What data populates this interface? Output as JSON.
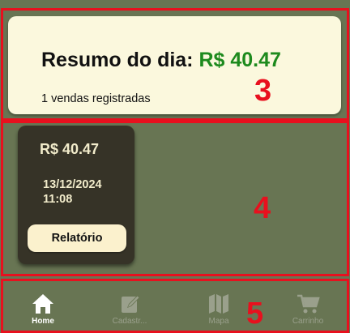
{
  "summary": {
    "title": "Resumo do dia:",
    "amount": "R$ 40.47",
    "subtitle": "1 vendas registradas"
  },
  "sales": [
    {
      "amount": "R$ 40.47",
      "date": "13/12/2024",
      "time": "11:08",
      "report_label": "Relatório"
    }
  ],
  "nav": {
    "items": [
      {
        "label": "Home",
        "icon": "home-icon",
        "active": true
      },
      {
        "label": "Cadastr...",
        "icon": "edit-icon",
        "active": false
      },
      {
        "label": "Mapa",
        "icon": "map-icon",
        "active": false
      },
      {
        "label": "Carrinho",
        "icon": "cart-icon",
        "active": false
      }
    ]
  },
  "annotations": {
    "summary_region": "3",
    "list_region": "4",
    "nav_region": "5"
  },
  "colors": {
    "background": "#687553",
    "summary_card": "#fbf8dd",
    "amount_green": "#1d8a1d",
    "sale_card": "#363327",
    "annotation_red": "#e8101e",
    "nav_inactive": "#9aa08c",
    "nav_active": "#ffffff"
  }
}
